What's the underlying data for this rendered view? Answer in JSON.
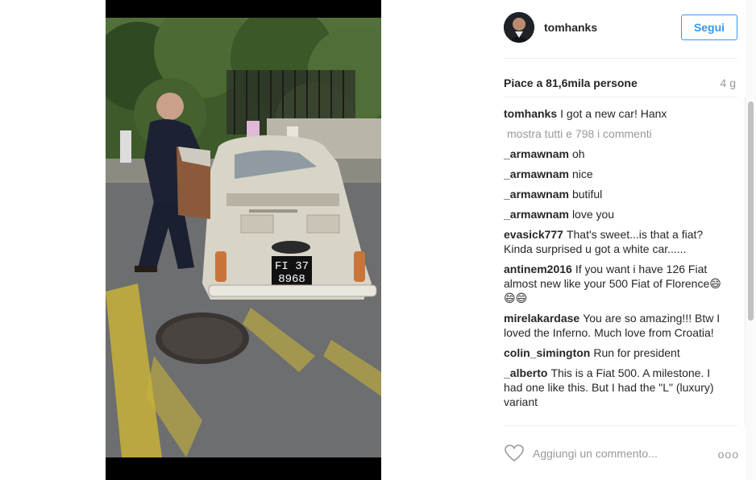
{
  "post": {
    "username": "tomhanks",
    "follow_label": "Segui",
    "likes_text": "Piace a 81,6mila persone",
    "time_ago": "4 g",
    "show_all_label": "mostra tutti e 798 i commenti",
    "comment_placeholder": "Aggiungi un commento...",
    "more_label": "ooo",
    "plate_line1": "FI 37",
    "plate_line2": "8968"
  },
  "comments": [
    {
      "user": "tomhanks",
      "text": "I got a new car! Hanx"
    },
    {
      "user": "_armawnam",
      "text": "oh"
    },
    {
      "user": "_armawnam",
      "text": "nice"
    },
    {
      "user": "_armawnam",
      "text": "butiful"
    },
    {
      "user": "_armawnam",
      "text": "love you"
    },
    {
      "user": "evasick777",
      "text": "That's sweet...is that a fiat? Kinda surprised u got a white car......"
    },
    {
      "user": "antinem2016",
      "text": "If you want i have 126 Fiat almost new like your 500 Fiat of Florence😄😄😄"
    },
    {
      "user": "mirelakardase",
      "text": "You are so amazing!!! Btw I loved the Inferno. Much love from Croatia!"
    },
    {
      "user": "colin_simington",
      "text": "Run for president"
    },
    {
      "user": "_alberto",
      "text": "This is a Fiat 500. A milestone. I had one like this. But I had the \"L\" (luxury) variant"
    }
  ],
  "colors": {
    "accent": "#3897f0",
    "text": "#262626",
    "muted": "#999999"
  },
  "icons": {
    "heart": "heart-outline-icon",
    "more": "ellipsis-icon"
  }
}
